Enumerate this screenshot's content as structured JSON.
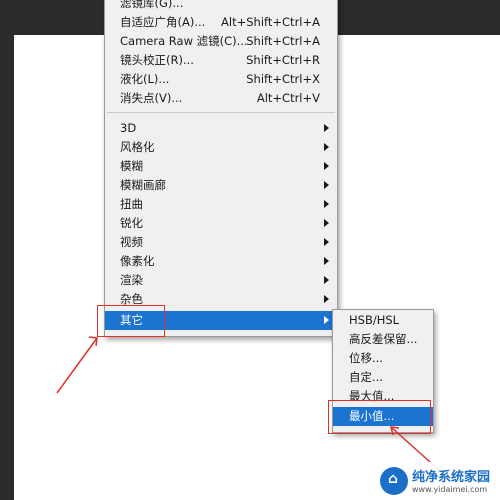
{
  "filter_menu": {
    "items": [
      {
        "label": "滤镜库(G)...",
        "shortcut": ""
      },
      {
        "label": "自适应广角(A)...",
        "shortcut": "Alt+Shift+Ctrl+A"
      },
      {
        "label": "Camera Raw 滤镜(C)...",
        "shortcut": "Shift+Ctrl+A"
      },
      {
        "label": "镜头校正(R)...",
        "shortcut": "Shift+Ctrl+R"
      },
      {
        "label": "液化(L)...",
        "shortcut": "Shift+Ctrl+X"
      },
      {
        "label": "消失点(V)...",
        "shortcut": "Alt+Ctrl+V"
      }
    ],
    "categories": [
      {
        "label": "3D"
      },
      {
        "label": "风格化"
      },
      {
        "label": "模糊"
      },
      {
        "label": "模糊画廊"
      },
      {
        "label": "扭曲"
      },
      {
        "label": "锐化"
      },
      {
        "label": "视频"
      },
      {
        "label": "像素化"
      },
      {
        "label": "渲染"
      },
      {
        "label": "杂色"
      },
      {
        "label": "其它"
      }
    ]
  },
  "other_submenu": {
    "items": [
      {
        "label": "HSB/HSL"
      },
      {
        "label": "高反差保留..."
      },
      {
        "label": "位移..."
      },
      {
        "label": "自定..."
      },
      {
        "label": "最大值..."
      },
      {
        "label": "最小值..."
      }
    ]
  },
  "watermark": {
    "title": "纯净系统家园",
    "url": "www.yidaimei.com",
    "logo_icon": "house-icon"
  },
  "colors": {
    "highlight": "#1a74d0",
    "annotation": "#e0302a",
    "menu_bg": "#f0f0f0"
  }
}
